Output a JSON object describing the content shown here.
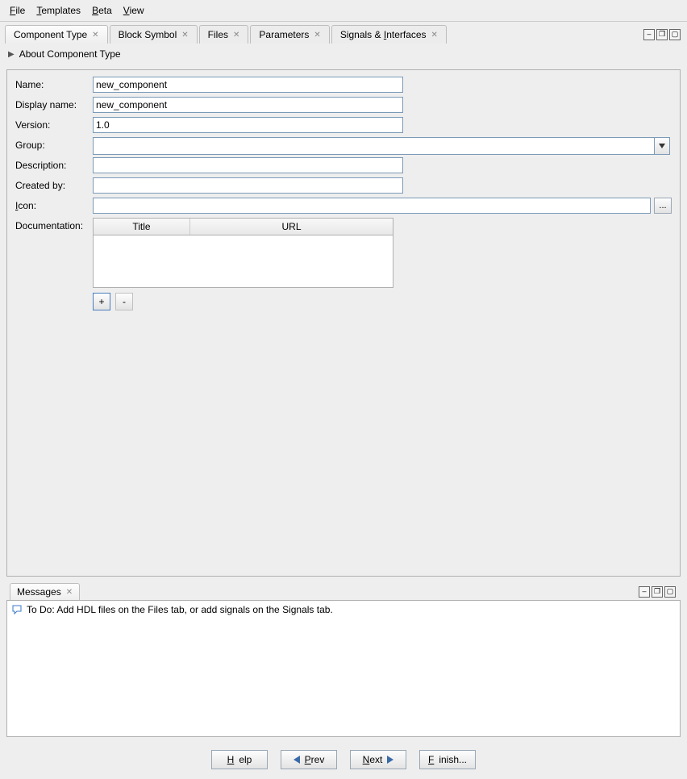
{
  "menu": {
    "file": "File",
    "templates": "Templates",
    "beta": "Beta",
    "view": "View"
  },
  "tabs": [
    {
      "label": "Component Type",
      "active": true
    },
    {
      "label": "Block Symbol",
      "active": false
    },
    {
      "label": "Files",
      "active": false
    },
    {
      "label": "Parameters",
      "active": false
    },
    {
      "label": "Signals & Interfaces",
      "active": false
    }
  ],
  "tabs_interfaces_underlined": "I",
  "section_title": "About Component Type",
  "form": {
    "name_label": "Name:",
    "name_value": "new_component",
    "display_name_label": "Display name:",
    "display_name_value": "new_component",
    "version_label": "Version:",
    "version_value": "1.0",
    "group_label": "Group:",
    "group_value": "",
    "description_label": "Description:",
    "description_value": "",
    "created_by_label": "Created by:",
    "created_by_value": "",
    "icon_label": "Icon:",
    "icon_value": "",
    "documentation_label": "Documentation:",
    "doc_col_title": "Title",
    "doc_col_url": "URL",
    "add_btn": "+",
    "remove_btn": "-",
    "browse_btn": "..."
  },
  "messages": {
    "tab_label": "Messages",
    "line1": "To Do: Add HDL files on the Files tab, or add signals on the Signals tab."
  },
  "footer": {
    "help": "Help",
    "prev": "Prev",
    "next": "Next",
    "finish": "Finish..."
  }
}
